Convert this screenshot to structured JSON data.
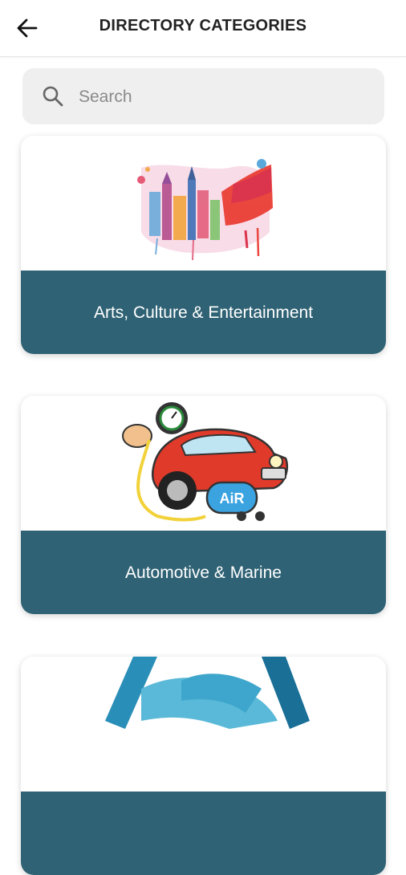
{
  "header": {
    "title": "DIRECTORY CATEGORIES",
    "back_icon": "arrow-left-icon"
  },
  "search": {
    "placeholder": "Search",
    "value": "",
    "icon": "search-icon"
  },
  "categories": [
    {
      "label": "Arts, Culture & Entertainment",
      "image": "watercolor-cityscape-illustration"
    },
    {
      "label": "Automotive & Marine",
      "image": "cartoon-red-car-air-compressor-illustration"
    },
    {
      "label": "",
      "image": "handshake-illustration"
    }
  ],
  "colors": {
    "card_label_bg": "#2f6274",
    "search_bg": "#efefef",
    "title_text": "#222222"
  }
}
